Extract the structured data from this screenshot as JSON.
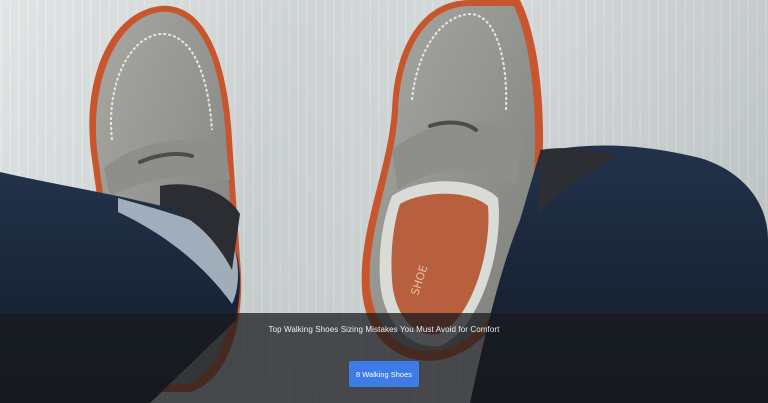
{
  "hero": {
    "caption": "Top Walking Shoes Sizing Mistakes You Must Avoid for Comfort",
    "cta_label": "8 Walking Shoes",
    "insole_stamp": "SHOE"
  },
  "colors": {
    "overlay": "#181a1e",
    "cta_background": "#3d7be6",
    "cta_text": "#ffffff",
    "caption_text": "#eef0f2"
  }
}
